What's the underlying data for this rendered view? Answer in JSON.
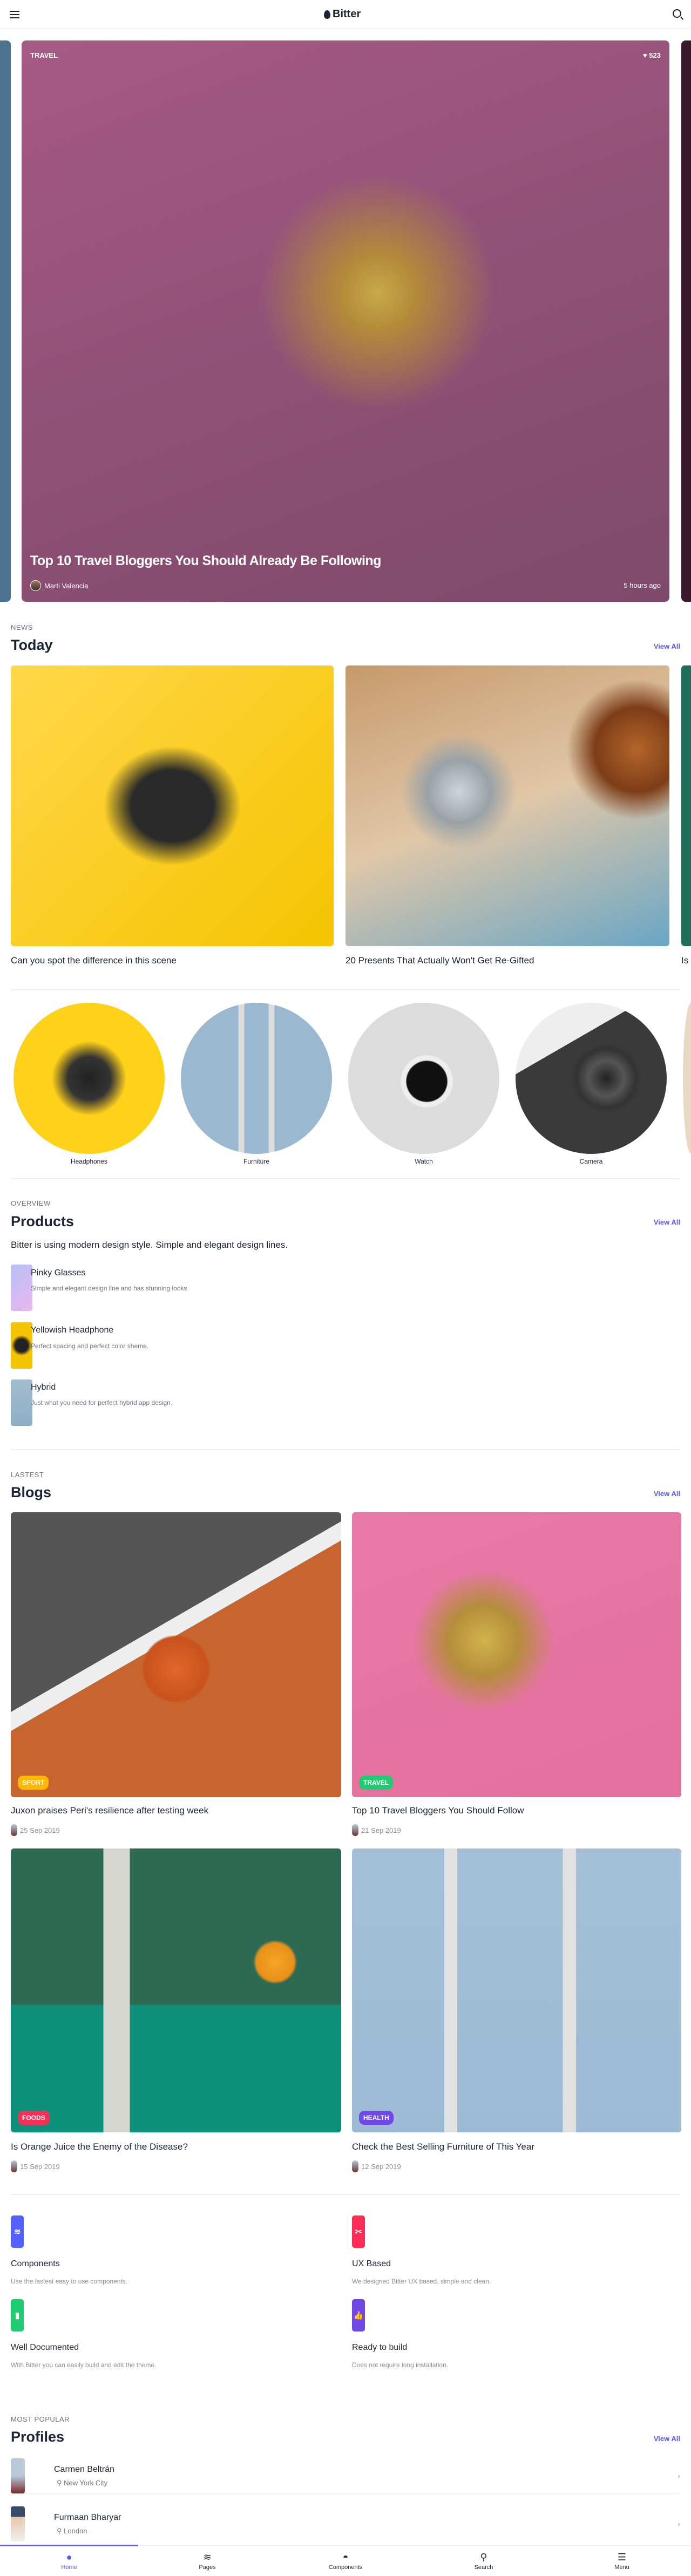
{
  "header": {
    "brand": "Bitter",
    "menu_icon": "hamburger-icon",
    "search_icon": "search-icon",
    "logo_icon": "drop-icon"
  },
  "hero": {
    "category": "TRAVEL",
    "likes": "523",
    "title": "Top 10 Travel Bloggers You Should Already Be Following",
    "author": "Marti Valencia",
    "time": "5 hours ago"
  },
  "today": {
    "kicker": "NEWS",
    "title": "Today",
    "view_all": "View All",
    "cards": [
      {
        "title": "Can you spot the difference in this scene"
      },
      {
        "title": "20 Presents That Actually Won't Get Re-Gifted"
      },
      {
        "title": "Is"
      }
    ]
  },
  "categories": [
    {
      "label": "Headphones"
    },
    {
      "label": "Furniture"
    },
    {
      "label": "Watch"
    },
    {
      "label": "Camera"
    }
  ],
  "products": {
    "kicker": "OVERVIEW",
    "title": "Products",
    "view_all": "View All",
    "description": "Bitter is using modern design style. Simple and elegant design lines.",
    "items": [
      {
        "name": "Pinky Glasses",
        "desc": "Simple and elegant design line and has stunning looks"
      },
      {
        "name": "Yellowish Headphone",
        "desc": "Perfect spacing and perfect color sheme."
      },
      {
        "name": "Hybrid",
        "desc": "Just what you need for perfect hybrid app design."
      }
    ]
  },
  "blogs": {
    "kicker": "LASTEST",
    "title": "Blogs",
    "view_all": "View All",
    "items": [
      {
        "badge": "SPORT",
        "badge_color": "#ffb800",
        "title": "Juxon praises Peri's resilience after testing week",
        "date": "25 Sep 2019"
      },
      {
        "badge": "TRAVEL",
        "badge_color": "#1fcc72",
        "title": "Top 10 Travel Bloggers You Should Follow",
        "date": "21 Sep 2019"
      },
      {
        "badge": "FOODS",
        "badge_color": "#ff2d55",
        "title": "Is Orange Juice the Enemy of the Disease?",
        "date": "15 Sep 2019"
      },
      {
        "badge": "HEALTH",
        "badge_color": "#7048e8",
        "title": "Check the Best Selling Furniture of This Year",
        "date": "12 Sep 2019"
      }
    ]
  },
  "features": [
    {
      "icon": "layers-icon",
      "color": "#5460fe",
      "title": "Components",
      "desc": "Use the lastest easy to use components."
    },
    {
      "icon": "scissors-icon",
      "color": "#ff2d55",
      "title": "UX Based",
      "desc": "We designed Bitter UX based, simple and clean."
    },
    {
      "icon": "folder-icon",
      "color": "#1fcc72",
      "title": "Well Documented",
      "desc": "With Bitter you can easily build and edit the theme."
    },
    {
      "icon": "thumbs-up-icon",
      "color": "#7048e8",
      "title": "Ready to build",
      "desc": "Does not require long installation."
    }
  ],
  "profiles": {
    "kicker": "MOST POPULAR",
    "title": "Profiles",
    "view_all": "View All",
    "items": [
      {
        "name": "Carmen Beltrán",
        "location": "New York City"
      },
      {
        "name": "Furmaan Bharyar",
        "location": "London"
      }
    ]
  },
  "bottom_nav": [
    {
      "label": "Home",
      "active": true
    },
    {
      "label": "Pages"
    },
    {
      "label": "Components"
    },
    {
      "label": "Search"
    },
    {
      "label": "Menu"
    }
  ],
  "accent": "#5b5ce6"
}
